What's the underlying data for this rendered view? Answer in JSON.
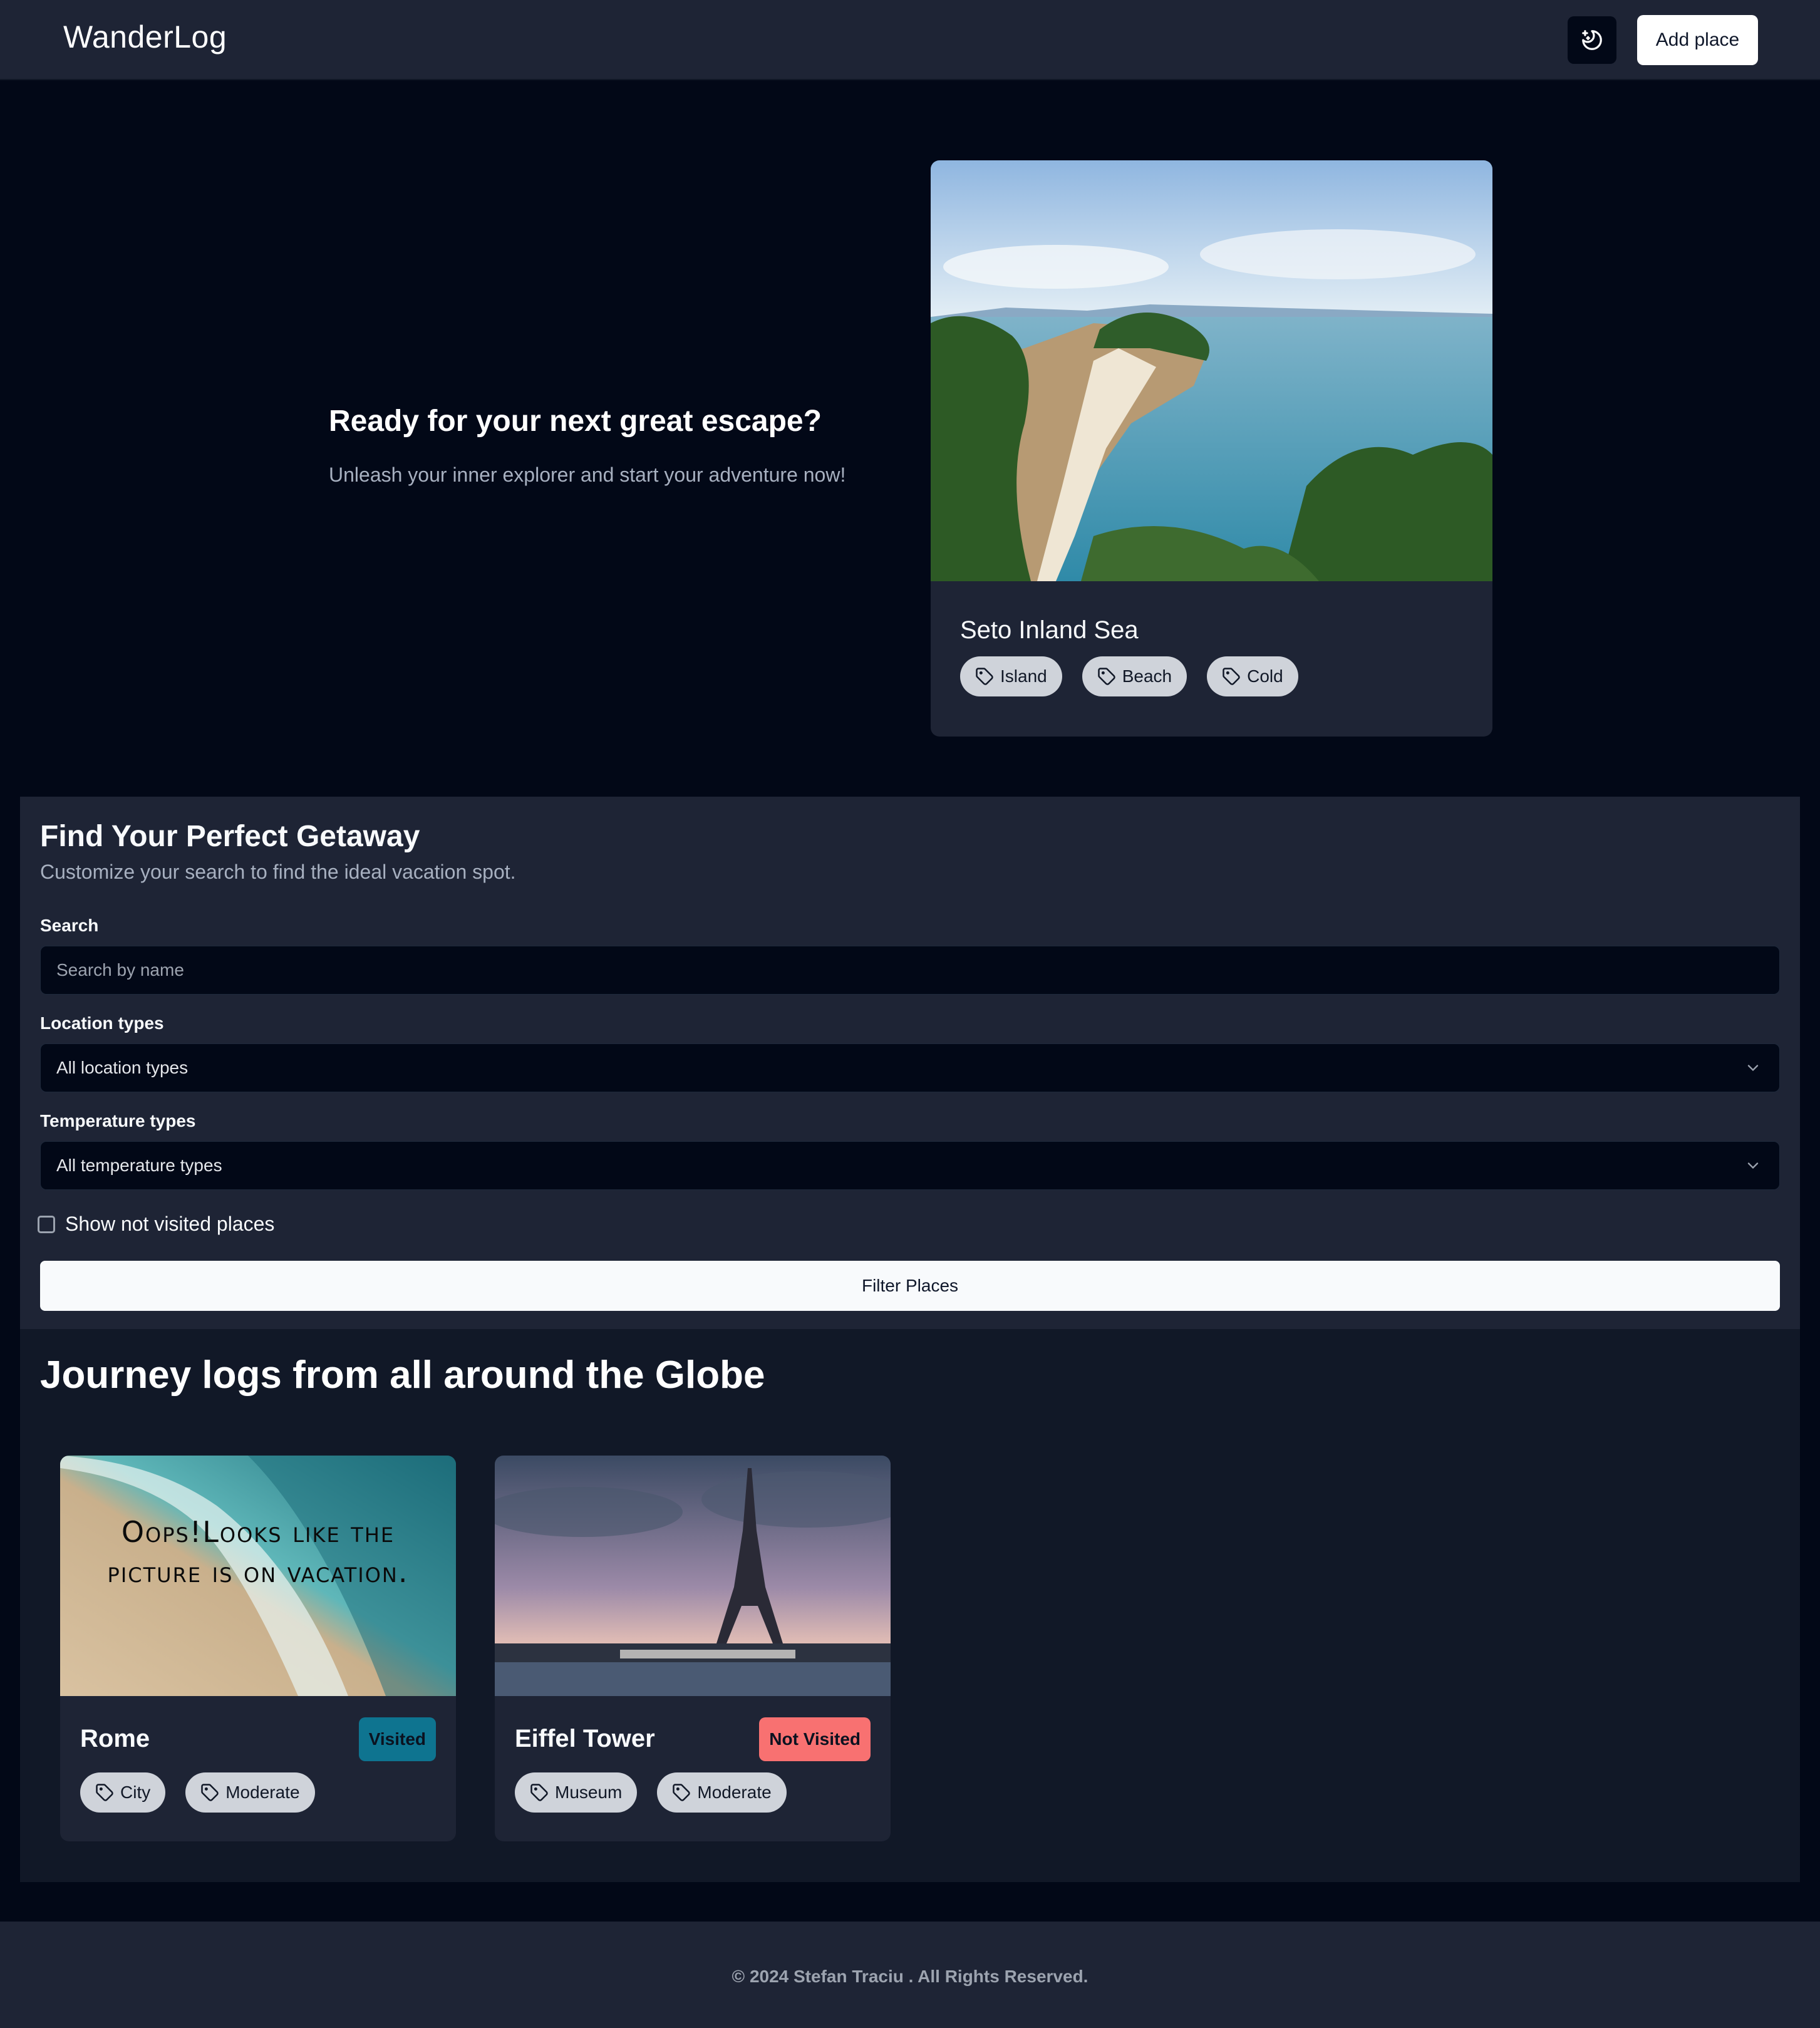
{
  "header": {
    "brand": "WanderLog",
    "theme_toggle_icon": "moon-stars-icon",
    "add_place_label": "Add place"
  },
  "hero": {
    "title": "Ready for your next great escape?",
    "subtitle": "Unleash your inner explorer and start your adventure now!",
    "featured": {
      "name": "Seto Inland Sea",
      "tags": [
        "Island",
        "Beach",
        "Cold"
      ]
    }
  },
  "filter": {
    "title": "Find Your Perfect Getaway",
    "subtitle": "Customize your search to find the ideal vacation spot.",
    "search_label": "Search",
    "search_placeholder": "Search by name",
    "location_label": "Location types",
    "location_value": "All location types",
    "temperature_label": "Temperature types",
    "temperature_value": "All temperature types",
    "checkbox_label": "Show not visited places",
    "checkbox_checked": false,
    "button_label": "Filter Places"
  },
  "journey": {
    "title": "Journey logs from all around the Globe",
    "places": [
      {
        "name": "Rome",
        "status": "Visited",
        "status_color": "#0e7490",
        "image_text": "Oops!Looks like the picture is on vacation.",
        "tags": [
          "City",
          "Moderate"
        ]
      },
      {
        "name": "Eiffel Tower",
        "status": "Not Visited",
        "status_color": "#f87171",
        "tags": [
          "Museum",
          "Moderate"
        ]
      }
    ]
  },
  "footer": {
    "text": "© 2024 Stefan Traciu . All Rights Reserved."
  },
  "colors": {
    "background": "#020817",
    "panel": "#1e2435",
    "tag_bg": "#cfd3da"
  }
}
